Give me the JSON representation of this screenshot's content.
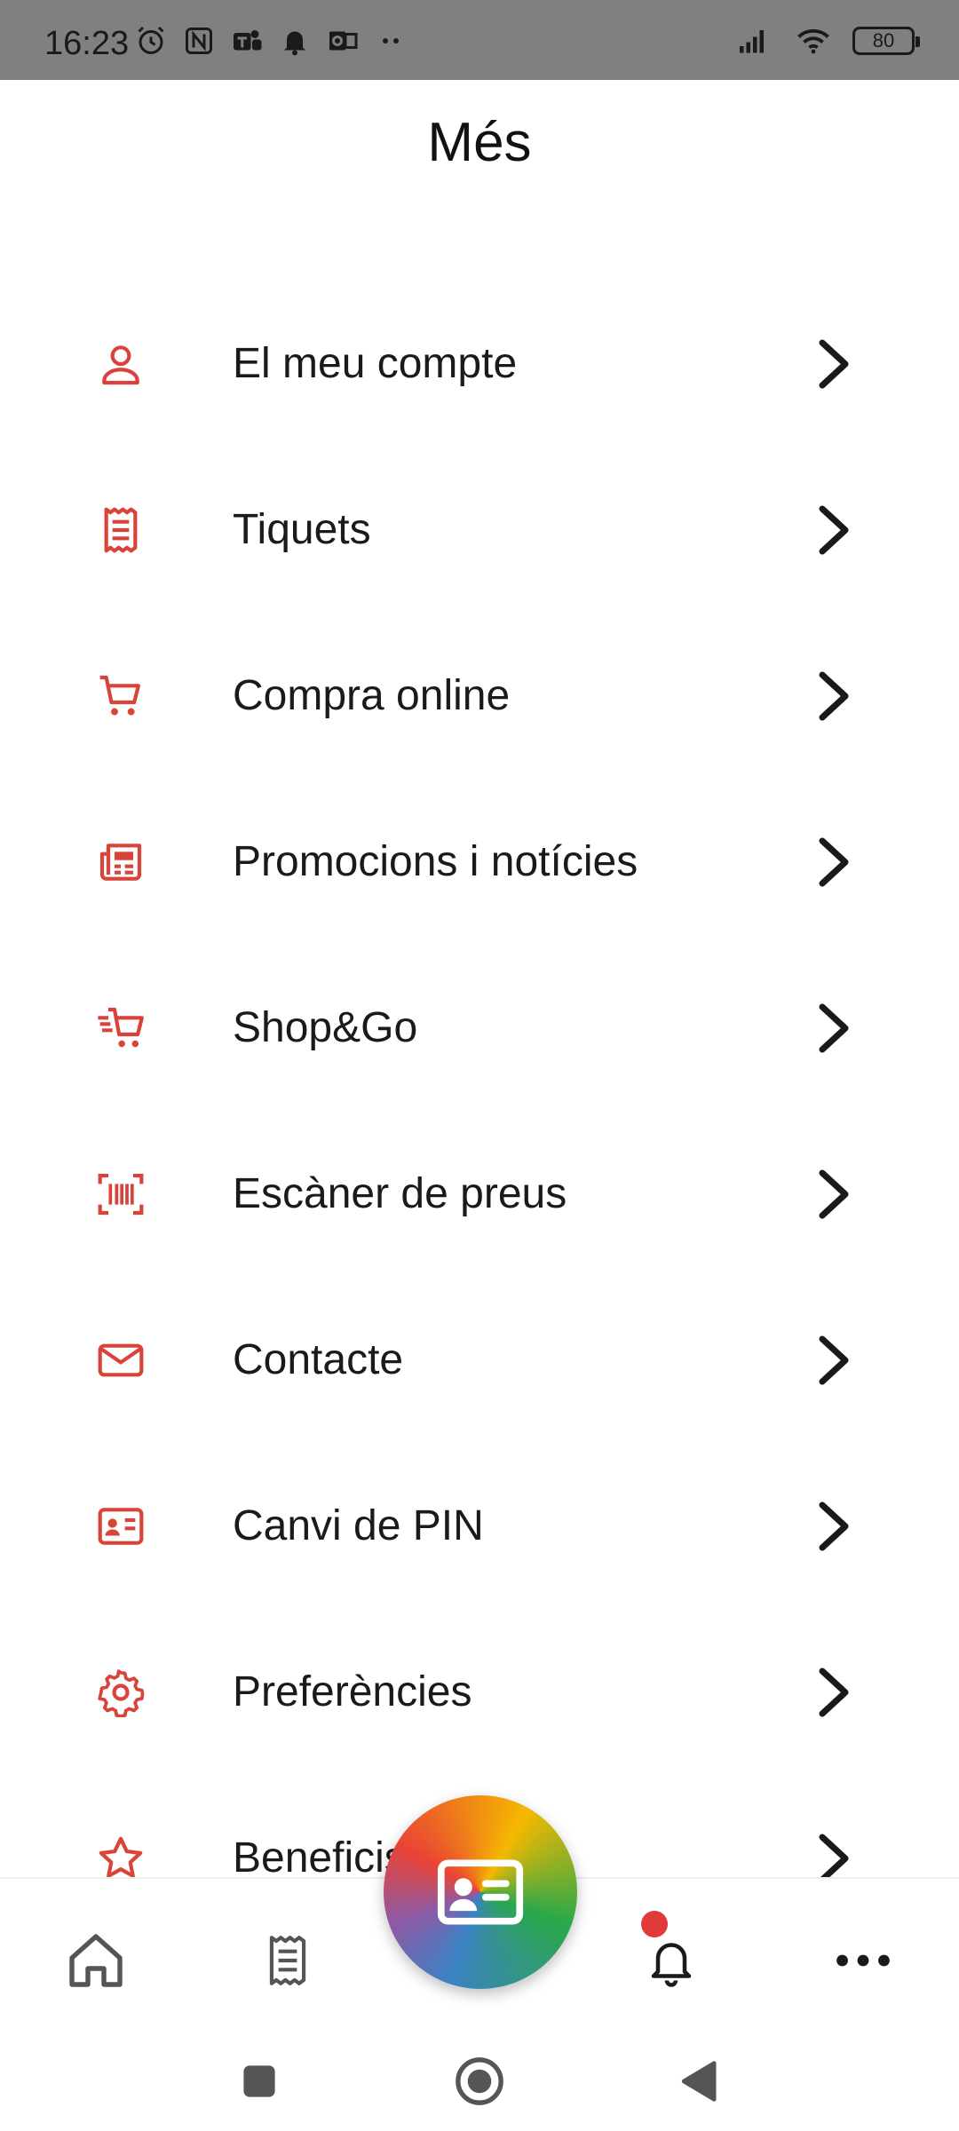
{
  "status_bar": {
    "time": "16:23",
    "battery": "80",
    "icons": [
      "alarm-icon",
      "nfc-icon",
      "teams-icon",
      "bell-icon",
      "outlook-icon",
      "more-dots-icon",
      "signal-icon",
      "wifi-icon",
      "battery-icon"
    ]
  },
  "header": {
    "title": "Més"
  },
  "menu": {
    "items": [
      {
        "label": "El meu compte",
        "icon": "user-icon"
      },
      {
        "label": "Tiquets",
        "icon": "receipt-icon"
      },
      {
        "label": "Compra online",
        "icon": "cart-icon"
      },
      {
        "label": "Promocions i notícies",
        "icon": "newspaper-icon"
      },
      {
        "label": "Shop&Go",
        "icon": "fast-cart-icon"
      },
      {
        "label": "Escàner de preus",
        "icon": "barcode-scanner-icon"
      },
      {
        "label": "Contacte",
        "icon": "mail-icon"
      },
      {
        "label": "Canvi de PIN",
        "icon": "id-card-icon"
      },
      {
        "label": "Preferències",
        "icon": "gear-icon"
      },
      {
        "label": "Beneficis",
        "icon": "star-icon"
      }
    ]
  },
  "bottom_nav": {
    "items": [
      "home-icon",
      "receipt-icon",
      "membership-card-icon",
      "bell-icon",
      "more-icon"
    ]
  },
  "colors": {
    "accent": "#d9443a",
    "text": "#1a1a1a",
    "status_bar": "#808080"
  }
}
